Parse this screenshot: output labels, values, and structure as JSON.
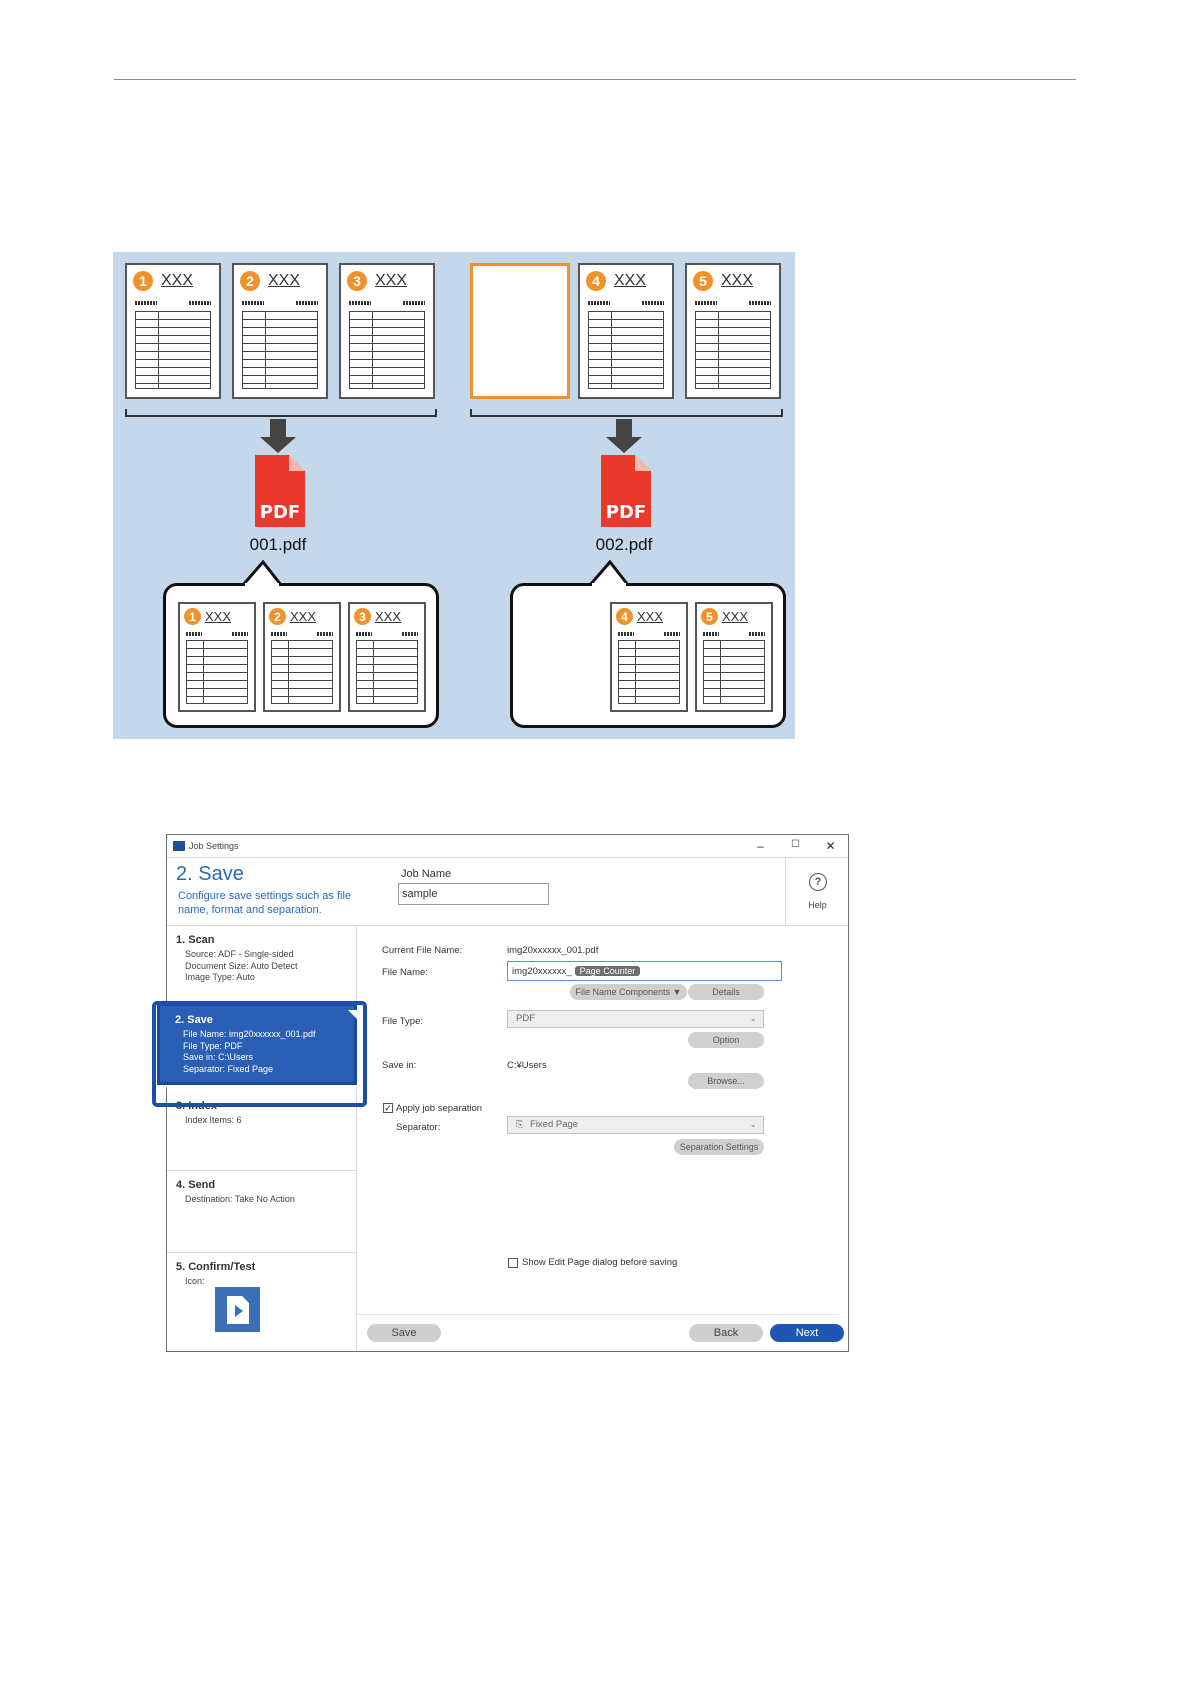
{
  "illustration": {
    "group1_pages": [
      {
        "num": "1",
        "title": "XXX"
      },
      {
        "num": "2",
        "title": "XXX"
      },
      {
        "num": "3",
        "title": "XXX"
      }
    ],
    "group2_pages": [
      {
        "num": "4",
        "title": "XXX"
      },
      {
        "num": "5",
        "title": "XXX"
      }
    ],
    "pdf_badge": "PDF",
    "pdf1_name": "001.pdf",
    "pdf2_name": "002.pdf",
    "blank_page_color": "#f0922a",
    "background_color": "#c5d7ea"
  },
  "dialog": {
    "window_title": "Job Settings",
    "window_buttons": {
      "minimize": "–",
      "maximize": "☐",
      "close": "✕"
    },
    "step_title": "2. Save",
    "step_desc": "Configure save settings such as file name, format and separation.",
    "job_name_label": "Job Name",
    "job_name_value": "sample",
    "help_label": "Help",
    "help_glyph": "?",
    "sidebar": [
      {
        "title": "1. Scan",
        "details": [
          "Source: ADF - Single-sided",
          "Document Size: Auto Detect",
          "Image Type: Auto"
        ]
      },
      {
        "title": "2. Save",
        "details": [
          "File Name: img20xxxxxx_001.pdf",
          "File Type: PDF",
          "Save in: C:\\Users",
          "Separator: Fixed Page"
        ]
      },
      {
        "title": "3. Index",
        "details": [
          "Index Items: 6"
        ]
      },
      {
        "title": "4. Send",
        "details": [
          "Destination: Take No Action"
        ]
      },
      {
        "title": "5. Confirm/Test",
        "details": [
          "Icon:"
        ]
      }
    ],
    "form": {
      "current_file_name_label": "Current File Name:",
      "current_file_name_value": "img20xxxxxx_001.pdf",
      "file_name_label": "File Name:",
      "file_name_value": "img20xxxxxx_",
      "file_name_token": "Page Counter",
      "file_name_components_button": "File Name Components ▼",
      "details_button": "Details",
      "file_type_label": "File Type:",
      "file_type_value": "PDF",
      "option_button": "Option",
      "save_in_label": "Save in:",
      "save_in_value": "C:¥Users",
      "browse_button": "Browse...",
      "apply_separation_label": "Apply job separation",
      "apply_separation_checked": true,
      "separator_label": "Separator:",
      "separator_value": "Fixed Page",
      "separation_settings_button": "Separation Settings",
      "show_edit_page_label": "Show Edit Page dialog before saving",
      "show_edit_page_checked": false
    },
    "footer": {
      "save": "Save",
      "back": "Back",
      "next": "Next"
    },
    "accent_color": "#1e56b3"
  }
}
